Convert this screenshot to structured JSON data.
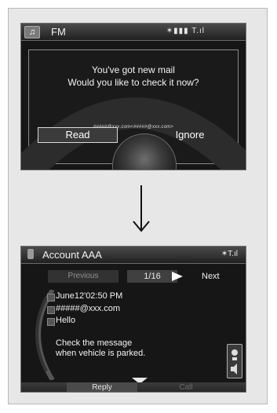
{
  "screen1": {
    "topbar": {
      "title": "FM",
      "status": "✶▮▮▮ T.ıl"
    },
    "dialog": {
      "line1": "You've got new mail",
      "line2": "Would you like to check it now?",
      "address": "#####@xxx.com<#####@xxx.com>",
      "read_label": "Read",
      "ignore_label": "Ignore"
    }
  },
  "screen2": {
    "topbar": {
      "title": "Account AAA",
      "status": "✶T.ıl"
    },
    "nav": {
      "prev_label": "Previous",
      "page": "1/16",
      "next_label": "Next"
    },
    "message": {
      "datetime": "June12'02:50 PM",
      "from": "#####@xxx.com",
      "subject": "Hello",
      "notice_line1": "Check the message",
      "notice_line2": "when vehicle is parked."
    },
    "bottombar": {
      "reply_label": "Reply",
      "call_label": "Call"
    }
  },
  "colors": {
    "screen_bg": "#161616",
    "frame_bg": "#e7e7e7",
    "text": "#f2f2f2"
  },
  "icons": [
    "music-icon",
    "phone-icon",
    "bluetooth-icon",
    "signal-icon",
    "arrow-down-icon",
    "next-arrow-icon",
    "scroll-down-icon",
    "speaker-icon"
  ]
}
